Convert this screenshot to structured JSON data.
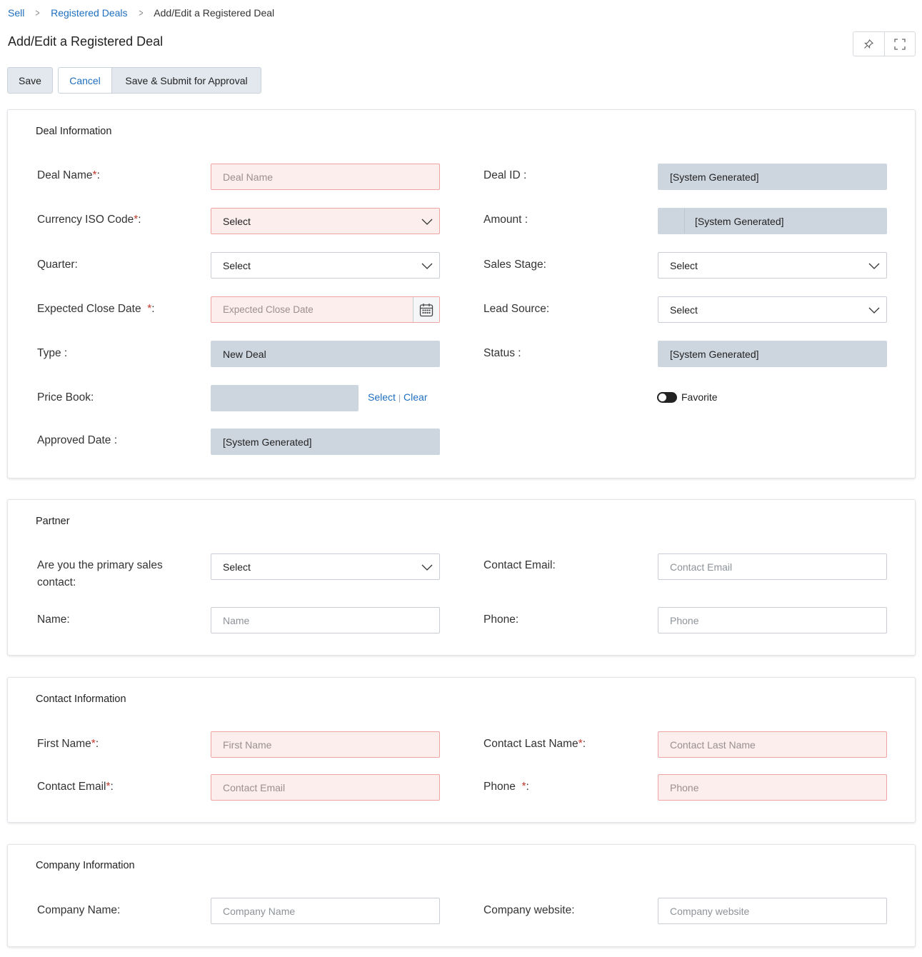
{
  "breadcrumb": {
    "items": [
      "Sell",
      "Registered Deals"
    ],
    "current": "Add/Edit a Registered Deal"
  },
  "page": {
    "title": "Add/Edit a Registered Deal"
  },
  "toolbar": {
    "save_label": "Save",
    "cancel_label": "Cancel",
    "submit_label": "Save & Submit for Approval"
  },
  "deal_info": {
    "title": "Deal Information",
    "deal_name_label": "Deal Name",
    "deal_name_placeholder": "Deal Name",
    "deal_id_label": "Deal ID :",
    "deal_id_value": "[System Generated]",
    "currency_label": "Currency ISO Code",
    "currency_value": "Select",
    "amount_label": "Amount :",
    "amount_value": "[System Generated]",
    "quarter_label": "Quarter:",
    "quarter_value": "Select",
    "sales_stage_label": "Sales Stage:",
    "sales_stage_value": "Select",
    "close_date_label": "Expected Close Date",
    "close_date_placeholder": "Expected Close Date",
    "lead_source_label": "Lead Source:",
    "lead_source_value": "Select",
    "type_label": "Type :",
    "type_value": "New Deal",
    "status_label": "Status :",
    "status_value": "[System Generated]",
    "price_book_label": "Price Book:",
    "price_book_select": "Select",
    "price_book_clear": "Clear",
    "favorite_label": "Favorite",
    "approved_date_label": "Approved Date :",
    "approved_date_value": "[System Generated]"
  },
  "partner": {
    "title": "Partner",
    "primary_contact_label": "Are you the primary sales contact:",
    "primary_contact_value": "Select",
    "contact_email_label": "Contact Email:",
    "contact_email_placeholder": "Contact Email",
    "name_label": "Name:",
    "name_placeholder": "Name",
    "phone_label": "Phone:",
    "phone_placeholder": "Phone"
  },
  "contact_info": {
    "title": "Contact Information",
    "first_name_label": "First Name",
    "first_name_placeholder": "First Name",
    "last_name_label": "Contact Last Name",
    "last_name_placeholder": "Contact Last Name",
    "email_label": "Contact Email",
    "email_placeholder": "Contact Email",
    "phone_label": "Phone",
    "phone_placeholder": "Phone"
  },
  "company_info": {
    "title": "Company Information",
    "company_name_label": "Company Name:",
    "company_name_placeholder": "Company Name",
    "website_label": "Company website:",
    "website_placeholder": "Company website"
  },
  "required_marker": "*",
  "required_suffix": ":",
  "colors": {
    "link": "#1f6fbf",
    "required_bg": "#fdeeee",
    "required_border": "#f0a3a3",
    "readonly_bg": "#cdd5df",
    "required_star": "#c0392b"
  }
}
